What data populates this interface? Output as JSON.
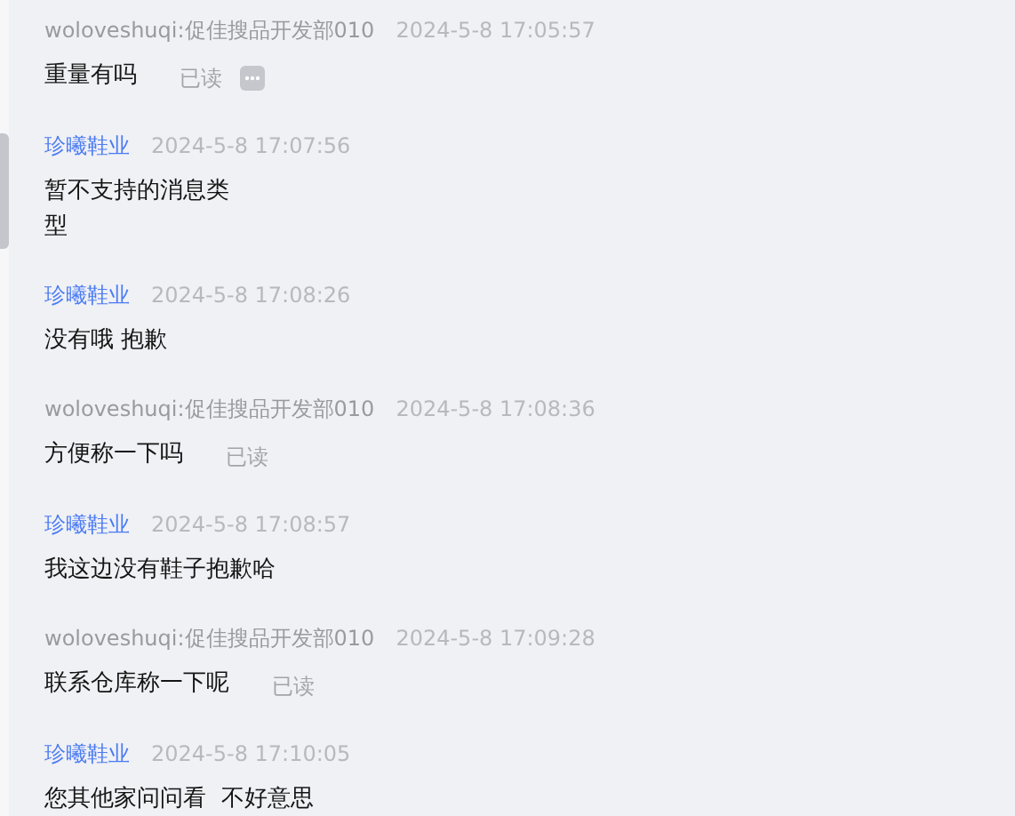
{
  "messages": [
    {
      "kind": "sent",
      "sender": "woloveshuqi:促佳搜品开发部010",
      "time": "2024-5-8 17:05:57",
      "text": "重量有吗",
      "read_receipt": "已读",
      "more_button": true
    },
    {
      "kind": "received",
      "sender": "珍曦鞋业",
      "time": "2024-5-8 17:07:56",
      "text": "暂不支持的消息类型",
      "narrow": true
    },
    {
      "kind": "received",
      "sender": "珍曦鞋业",
      "time": "2024-5-8 17:08:26",
      "text": "没有哦 抱歉"
    },
    {
      "kind": "sent",
      "sender": "woloveshuqi:促佳搜品开发部010",
      "time": "2024-5-8 17:08:36",
      "text": "方便称一下吗",
      "read_receipt": "已读"
    },
    {
      "kind": "received",
      "sender": "珍曦鞋业",
      "time": "2024-5-8 17:08:57",
      "text": "我这边没有鞋子抱歉哈"
    },
    {
      "kind": "sent",
      "sender": "woloveshuqi:促佳搜品开发部010",
      "time": "2024-5-8 17:09:28",
      "text": "联系仓库称一下呢",
      "read_receipt": "已读"
    },
    {
      "kind": "received",
      "sender": "珍曦鞋业",
      "time": "2024-5-8 17:10:05",
      "text": "您其他家问问看  不好意思"
    }
  ]
}
